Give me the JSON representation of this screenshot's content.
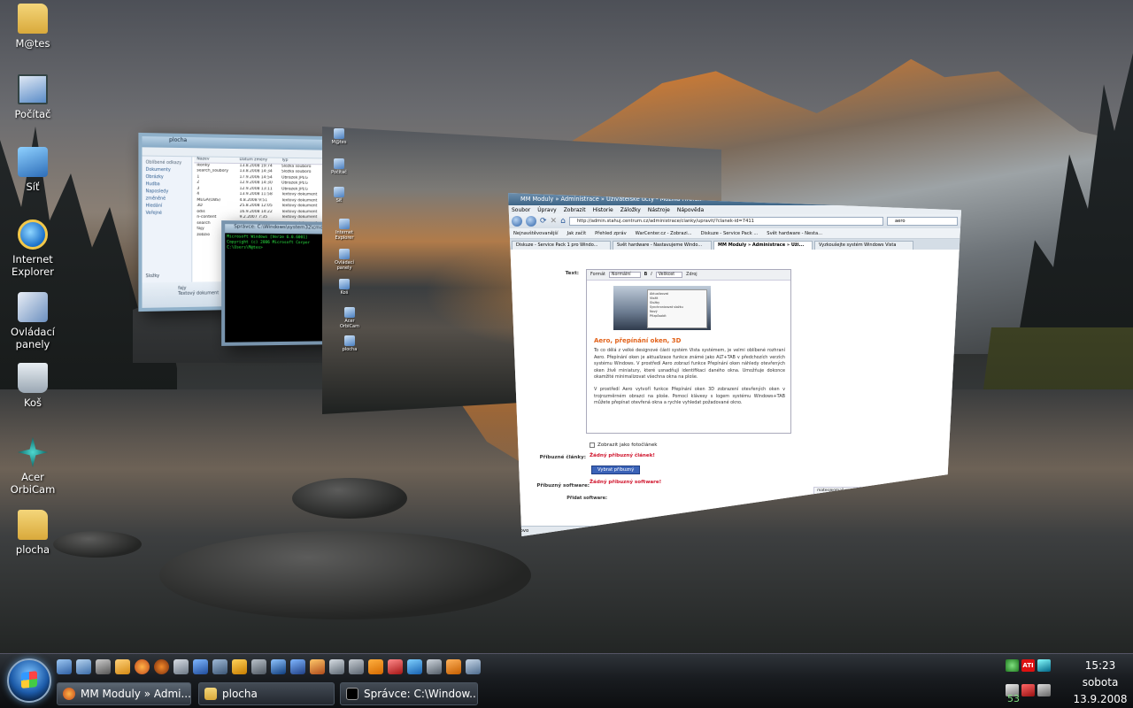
{
  "desktop_icons": [
    {
      "id": "mates",
      "label": "M@tes",
      "icon": "user-folder-icon"
    },
    {
      "id": "pocitac",
      "label": "Počítač",
      "icon": "computer-icon"
    },
    {
      "id": "sit",
      "label": "Síť",
      "icon": "network-icon"
    },
    {
      "id": "ie",
      "label": "Internet Explorer",
      "icon": "internet-explorer-icon"
    },
    {
      "id": "ovladaci",
      "label": "Ovládací panely",
      "icon": "control-panel-icon"
    },
    {
      "id": "kos",
      "label": "Koš",
      "icon": "recycle-bin-icon"
    },
    {
      "id": "orbicam",
      "label": "Acer OrbiCam",
      "icon": "orbicam-icon"
    },
    {
      "id": "plocha",
      "label": "plocha",
      "icon": "folder-icon"
    }
  ],
  "explorer": {
    "breadcrumb": "plocha",
    "side_title": "Oblíbené odkazy",
    "side_items": [
      "Dokumenty",
      "Obrázky",
      "Hudba",
      "Naposledy změněné",
      "Hledání",
      "Veřejné"
    ],
    "side_footer": "Složky",
    "columns": [
      "Název",
      "Datum změny",
      "Typ"
    ],
    "rows": [
      [
        "ikonky",
        "13.8.2008 19:74",
        "Složka souborů"
      ],
      [
        "search_soubory",
        "13.8.2008 14:34",
        "Složka souborů"
      ],
      [
        "1",
        "17.9.2006 14:54",
        "Obrázek JPEG"
      ],
      [
        "2",
        "12.9.2008 14:30",
        "Obrázek JPEG"
      ],
      [
        "3",
        "12.9.2008 13:11",
        "Obrázek JPEG"
      ],
      [
        "4",
        "13.9.2008 11:58",
        "Textový dokument"
      ],
      [
        "MEGA(OBS)",
        "4.8.2008 9:51",
        "Textový dokument"
      ],
      [
        "3D",
        "25.8.2008 12:05",
        "Textový dokument"
      ],
      [
        "odis",
        "16.9.2008 14:22",
        "Textový dokument"
      ],
      [
        "n-content",
        "9.2.2007 7:35",
        "Textový dokument"
      ],
      [
        "search",
        "11.8.2008 11:28",
        "Textový dokument"
      ],
      [
        "fajy",
        "18.8.2008 13:12",
        "Textový dokument"
      ],
      [
        "zobzio",
        "11.9.2008 13:38",
        "Textový dokument"
      ]
    ],
    "footer_name": "fajy",
    "footer_type": "Textový dokument"
  },
  "cmd": {
    "title": "Správce: C:\\Windows\\system32\\cmd.exe",
    "lines": [
      "Microsoft Windows [Verze 6.0.6001]",
      "Copyright (c) 2006 Microsoft Corpor",
      "",
      "C:\\Users\\M@tes>"
    ]
  },
  "desktop_preview_icons": [
    "M@tes",
    "Počítač",
    "Síť",
    "Internet Explorer",
    "Ovládací panely",
    "Koš",
    "Acer OrbiCam",
    "plocha"
  ],
  "firefox": {
    "title": "MM Moduly » Administrace » Uživatelské účty - Mozilla Firefox",
    "menu": [
      "Soubor",
      "Úpravy",
      "Zobrazit",
      "Historie",
      "Záložky",
      "Nástroje",
      "Nápověda"
    ],
    "url": "http://admin.stahuj.centrum.cz/administrace/clanky/upravit/?clanek-id=7411",
    "search": "aero",
    "bookmarks": [
      "Nejnavštěvovanější",
      "Jak začít",
      "Přehled zpráv",
      "WarCenter.cz - Zobrazi...",
      "Diskuze - Service Pack ...",
      "Svět hardware - Nesta..."
    ],
    "tabs": [
      {
        "label": "Diskuze - Service Pack 1 pro Windo...",
        "active": false
      },
      {
        "label": "Svět hardware - Nastavujeme Windo...",
        "active": false
      },
      {
        "label": "MM Moduly » Administrace » Uži...",
        "active": true
      },
      {
        "label": "Vyzkoušejte systém Windows Vista",
        "active": false
      }
    ],
    "page": {
      "text_label": "Text:",
      "editor_format_label": "Formát",
      "editor_format_value": "Normální",
      "editor_size_label": "Velikost",
      "editor_source_label": "Zdroj",
      "context_menu": [
        "Aktualizovat",
        "Vložit",
        "Služby",
        "Synchronizovat složku",
        "Nový",
        "Přizpůsobit"
      ],
      "heading": "Aero, přepínání oken, 3D",
      "para1": "To co dělá z velké designové části systém Vista systémem, je velmi oblíbené rozhraní Aero. Přepínání oken je aktualizace funkce známé jako ALT+TAB v předchozích verzích systému Windows. V prostředí Aero zobrazí funkce Přepínání oken náhledy otevřených oken živě miniatury, které usnadňují identifikaci daného okna. Umožňuje dokonce okamžité minimalizovat všechna okna na ploše.",
      "para2": "V prostředí Aero vytvoří funkce Přepínání oken 3D zobrazení otevřených oken v trojrozměrném obrazci na ploše. Pomocí klávesy s logem systému Windows+TAB můžete přepínat otevřená okna a rychle vyhledat požadované okno.",
      "checkbox_label": "Zobrazit jako fotočlánek",
      "related_articles_label": "Příbuzné články:",
      "related_articles_value": "Žádný příbuzný článek!",
      "related_button": "Vybrat příbuzný",
      "related_sw_label": "Příbuzný software:",
      "related_sw_value": "Žádný příbuzný software!",
      "add_sw_label": "Přidat software:",
      "status_gmail": "mates@gmail.com",
      "status_weather1": "Nyní Slunečno, 18° C",
      "status_weather2": "Ne: 12° C",
      "status_weather3": "Po: 12° C"
    },
    "status": "Hotovo"
  },
  "taskbar": {
    "buttons": [
      {
        "label": "MM Moduly » Admi...",
        "icon": "firefox-icon",
        "active": true
      },
      {
        "label": "plocha",
        "icon": "folder-icon",
        "active": false
      },
      {
        "label": "Správce: C:\\Window...",
        "icon": "cmd-icon",
        "active": false
      }
    ],
    "tray_ati": "ATI",
    "tray_temp": "53",
    "clock_time": "15:23",
    "clock_day": "sobota",
    "clock_date": "13.9.2008"
  }
}
